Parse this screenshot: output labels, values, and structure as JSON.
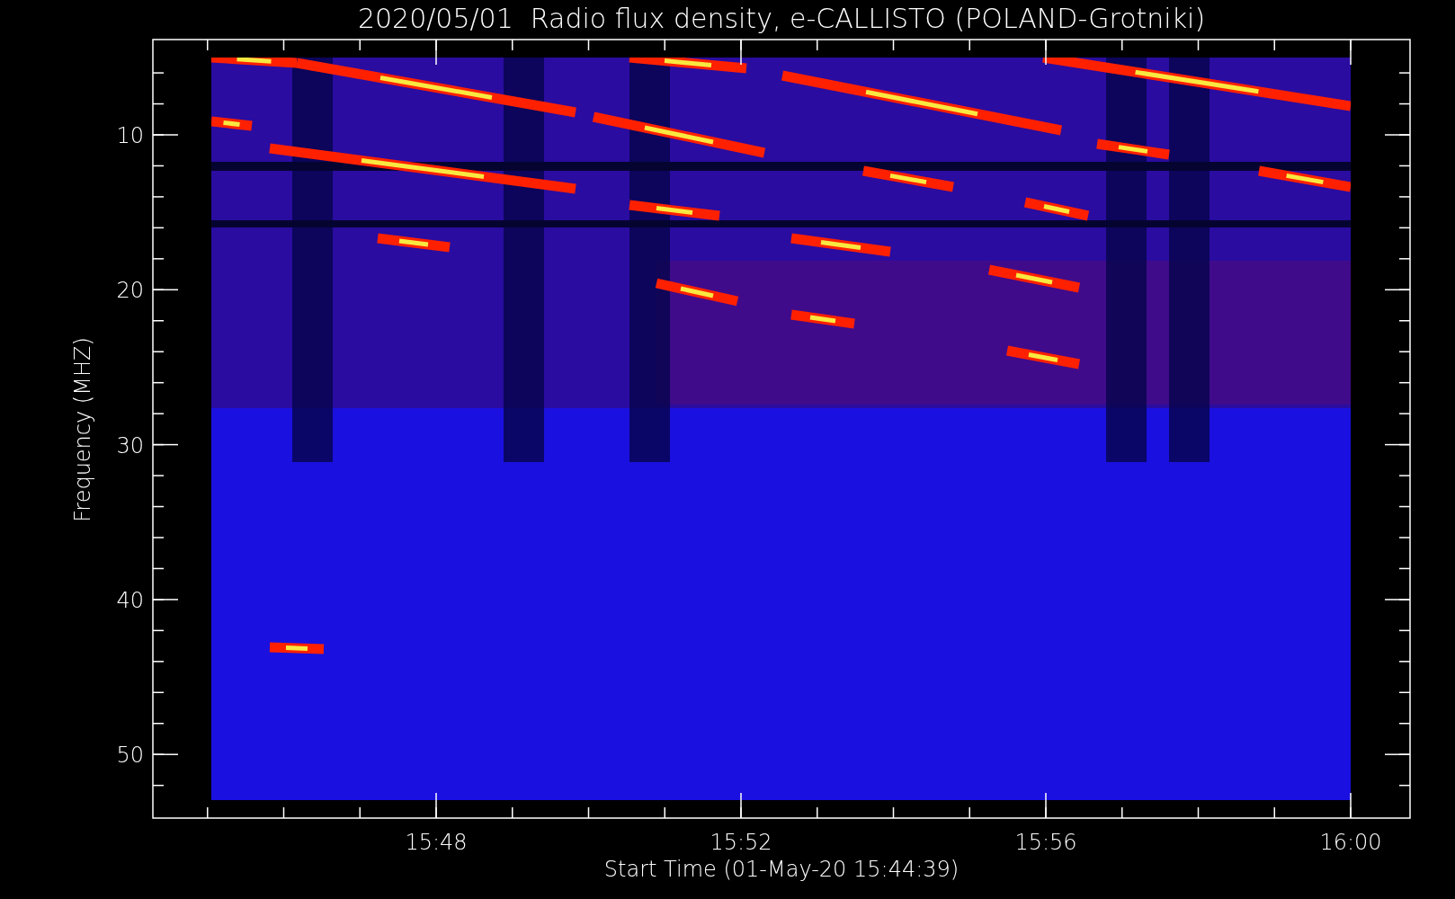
{
  "title": "2020/05/01  Radio flux density, e-CALLISTO (POLAND-Grotniki)",
  "y_axis": {
    "label": "Frequency (MHZ)",
    "ticks": [
      "10",
      "20",
      "30",
      "40",
      "50"
    ]
  },
  "x_axis": {
    "label": "Start Time (01-May-20 15:44:39)",
    "ticks": [
      "15:48",
      "15:52",
      "15:56",
      "16:00"
    ]
  }
}
